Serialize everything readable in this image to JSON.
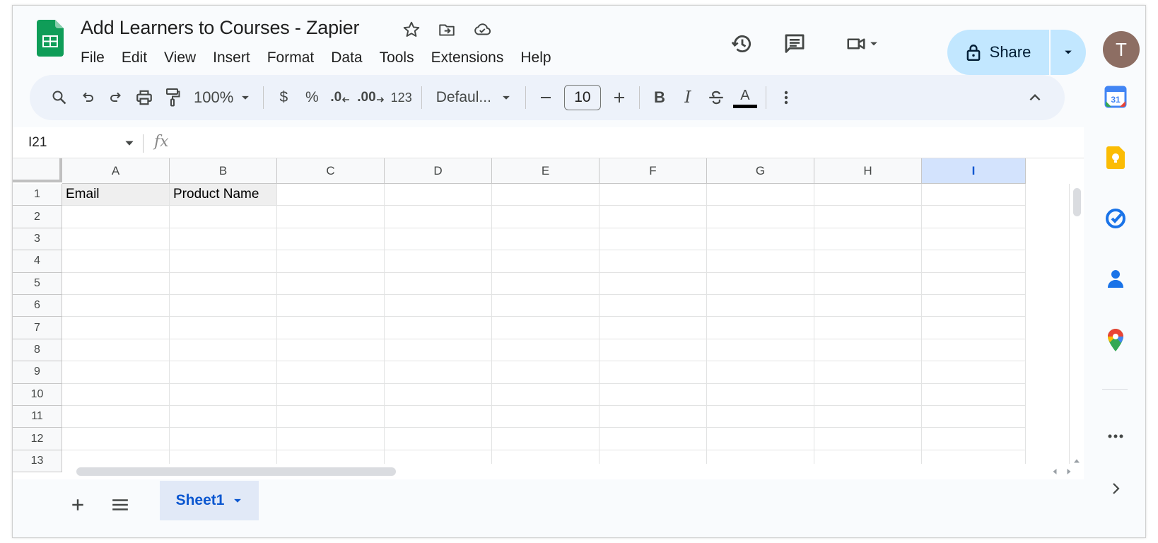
{
  "doc": {
    "title": "Add Learners to Courses - Zapier"
  },
  "menu": [
    "File",
    "Edit",
    "View",
    "Insert",
    "Format",
    "Data",
    "Tools",
    "Extensions",
    "Help"
  ],
  "share": {
    "label": "Share"
  },
  "avatar": {
    "initial": "T",
    "color": "#8d6e63"
  },
  "toolbar": {
    "zoom": "100%",
    "currency": "$",
    "percent": "%",
    "decrease_decimal": ".0",
    "increase_decimal": ".00",
    "number_format": "123",
    "font": "Defaul...",
    "font_size": "10",
    "bold": "B",
    "italic": "I",
    "text_color_label": "A",
    "text_color": "#000000"
  },
  "formula_bar": {
    "cell_ref": "I21",
    "fx_label": "fx",
    "value": ""
  },
  "columns": [
    "A",
    "B",
    "C",
    "D",
    "E",
    "F",
    "G",
    "H",
    "I"
  ],
  "selected_column": "I",
  "rows": [
    "1",
    "2",
    "3",
    "4",
    "5",
    "6",
    "7",
    "8",
    "9",
    "10",
    "11",
    "12",
    "13"
  ],
  "cells": {
    "A1": "Email",
    "B1": "Product Name"
  },
  "sheets": [
    {
      "name": "Sheet1",
      "active": true
    }
  ],
  "colors": {
    "accent": "#0b57d0",
    "share_bg": "#c2e7ff",
    "toolbar_bg": "#edf2fa",
    "header_fill": "#efefef"
  }
}
